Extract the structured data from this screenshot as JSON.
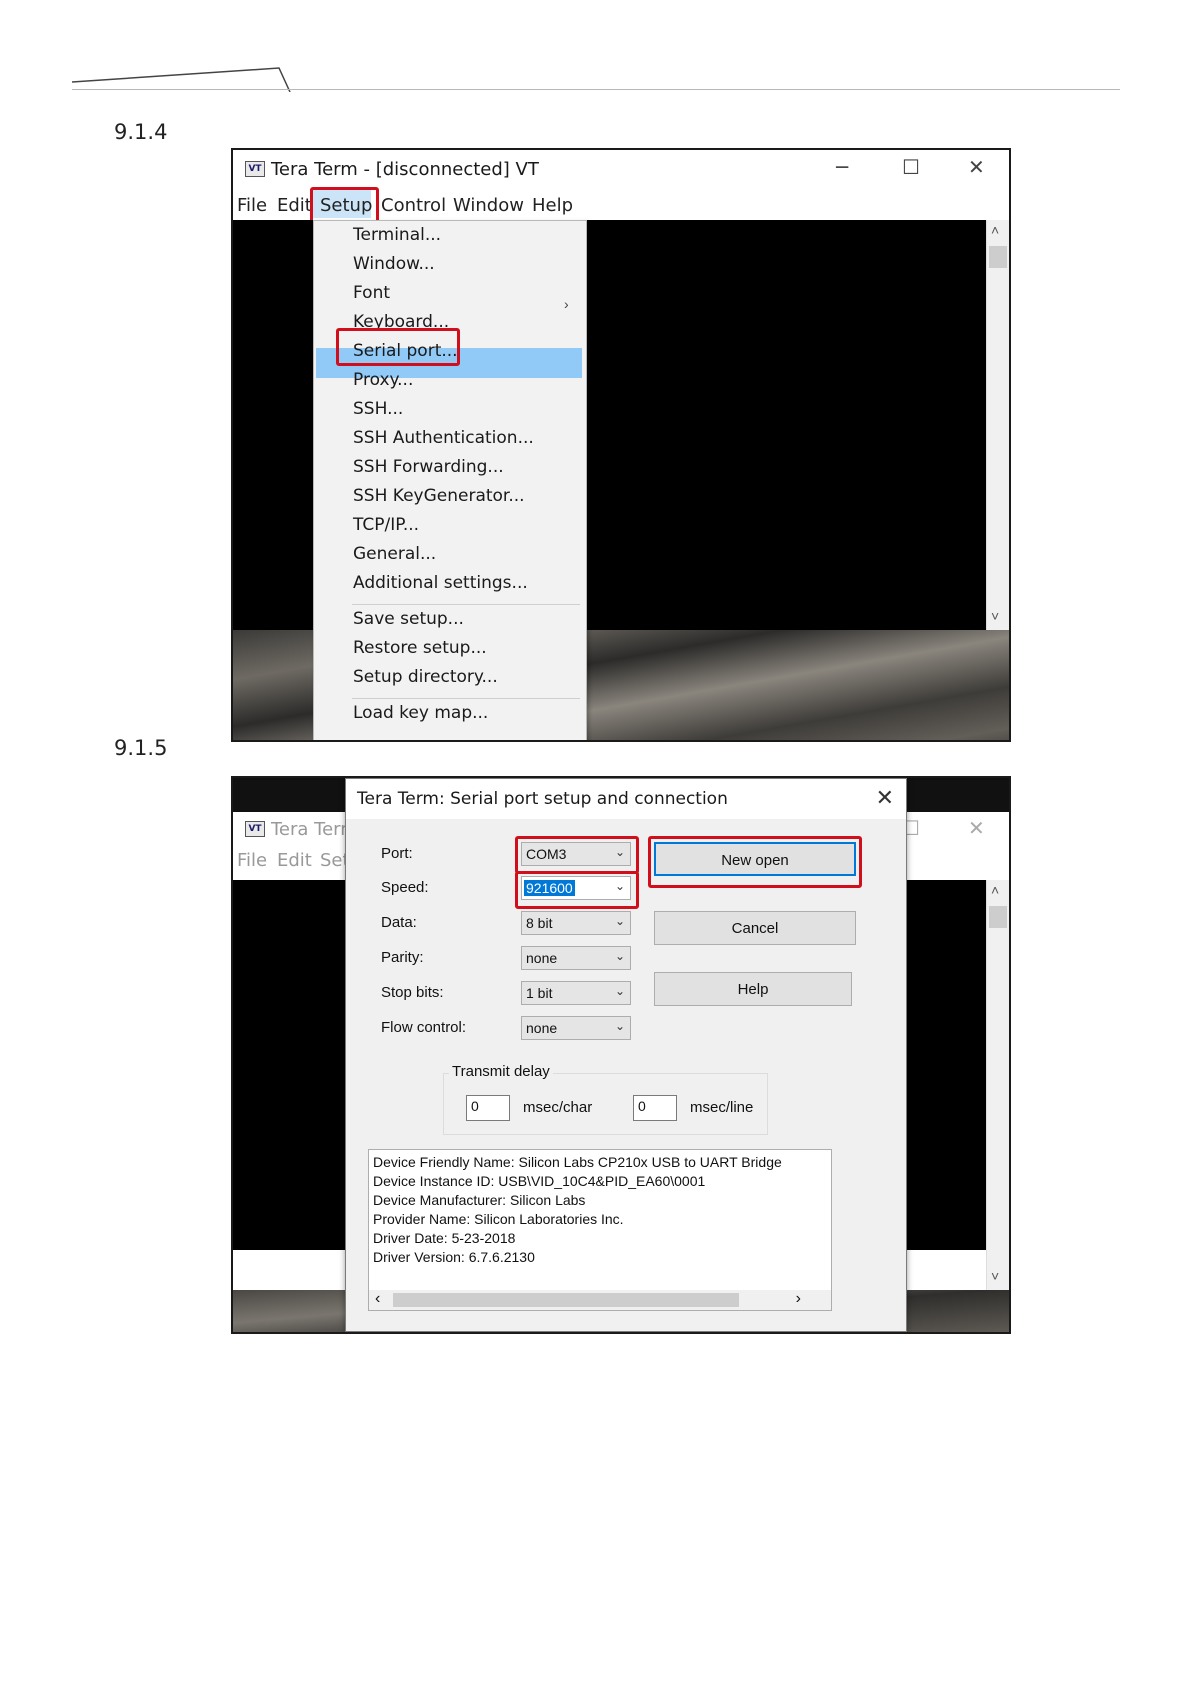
{
  "sections": {
    "first": "9.1.4",
    "second": "9.1.5"
  },
  "shot1": {
    "icon_label": "VT",
    "window_title": "Tera Term - [disconnected] VT",
    "window_buttons": {
      "minimize": "─",
      "maximize": "☐",
      "close": "✕"
    },
    "menubar": [
      "File",
      "Edit",
      "Setup",
      "Control",
      "Window",
      "Help"
    ],
    "setup_menu": {
      "items_group1": [
        "Terminal...",
        "Window...",
        "Font",
        "Keyboard...",
        "Serial port...",
        "Proxy...",
        "SSH...",
        "SSH Authentication...",
        "SSH Forwarding...",
        "SSH KeyGenerator...",
        "TCP/IP...",
        "General...",
        "Additional settings..."
      ],
      "items_group2": [
        "Save setup...",
        "Restore setup...",
        "Setup directory..."
      ],
      "items_group3": [
        "Load key map..."
      ],
      "submenu_arrow": "›",
      "highlighted_item": "Serial port..."
    },
    "scroll_up": "˄",
    "scroll_down": "˅"
  },
  "shot2": {
    "bg_window_title": "Tera Term",
    "bg_menu": [
      "File",
      "Edit",
      "Set"
    ],
    "dialog_title": "Tera Term: Serial port setup and connection",
    "dialog_close": "✕",
    "fields": [
      {
        "label": "Port:",
        "value": "COM3"
      },
      {
        "label": "Speed:",
        "value": "921600"
      },
      {
        "label": "Data:",
        "value": "8 bit"
      },
      {
        "label": "Parity:",
        "value": "none"
      },
      {
        "label": "Stop bits:",
        "value": "1 bit"
      },
      {
        "label": "Flow control:",
        "value": "none"
      }
    ],
    "buttons": {
      "new_open": "New open",
      "cancel": "Cancel",
      "help": "Help"
    },
    "transmit_delay": {
      "title": "Transmit delay",
      "char_value": "0",
      "char_unit": "msec/char",
      "line_value": "0",
      "line_unit": "msec/line"
    },
    "device_info": [
      "Device Friendly Name: Silicon Labs CP210x USB to UART Bridge",
      "Device Instance ID: USB\\VID_10C4&PID_EA60\\0001",
      "Device Manufacturer: Silicon Labs",
      "Provider Name: Silicon Laboratories Inc.",
      "Driver Date: 5-23-2018",
      "Driver Version: 6.7.6.2130"
    ],
    "chevron": "⌄",
    "scroll_left": "‹",
    "scroll_right": "›",
    "scroll_up": "˄",
    "scroll_down": "˅"
  },
  "colors": {
    "highlight_outline": "#d10f1c",
    "menu_selection": "#91c9f7",
    "primary_button_border": "#0078d7"
  }
}
